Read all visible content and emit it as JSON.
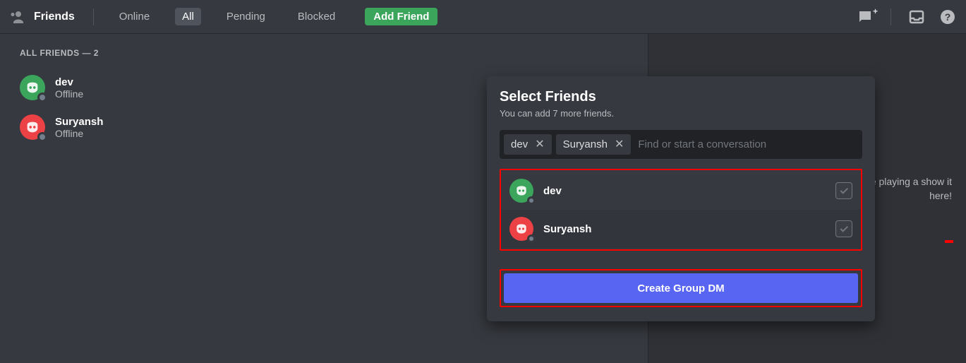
{
  "header": {
    "title": "Friends",
    "tabs": {
      "online": "Online",
      "all": "All",
      "pending": "Pending",
      "blocked": "Blocked"
    },
    "add_friend": "Add Friend"
  },
  "friends": {
    "section_title": "ALL FRIENDS — 2",
    "items": [
      {
        "name": "dev",
        "status": "Offline",
        "color": "green"
      },
      {
        "name": "Suryansh",
        "status": "Offline",
        "color": "red"
      }
    ]
  },
  "activity_hint": "ke playing a show it here!",
  "popout": {
    "title": "Select Friends",
    "subtitle": "You can add 7 more friends.",
    "chips": [
      {
        "label": "dev"
      },
      {
        "label": "Suryansh"
      }
    ],
    "search_placeholder": "Find or start a conversation",
    "list": [
      {
        "name": "dev",
        "color": "green"
      },
      {
        "name": "Suryansh",
        "color": "red"
      }
    ],
    "create_label": "Create Group DM"
  }
}
